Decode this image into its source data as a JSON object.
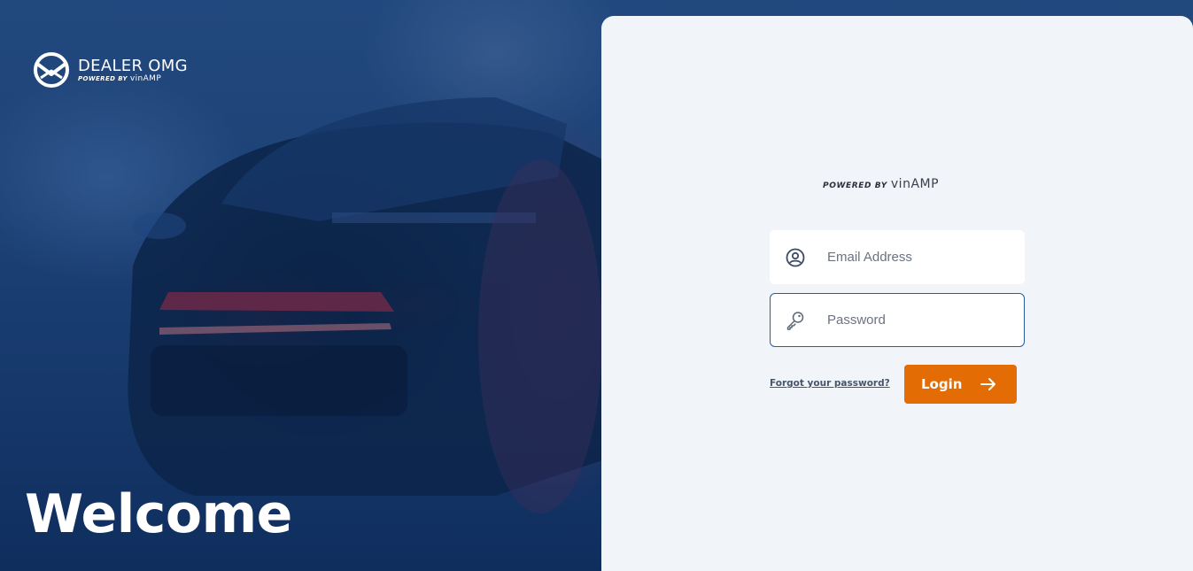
{
  "brand": {
    "name": "DEALER OMG",
    "powered_prefix": "POWERED BY",
    "powered_brand": "vinAMP"
  },
  "hero": {
    "welcome_text": "Welcome"
  },
  "login_panel": {
    "powered_prefix": "POWERED BY",
    "powered_brand": "vinAMP",
    "email": {
      "placeholder": "Email Address",
      "value": "",
      "icon": "user-circle-icon"
    },
    "password": {
      "placeholder": "Password",
      "value": "",
      "icon": "key-icon"
    },
    "forgot_link": "Forgot your password?",
    "login_button": {
      "label": "Login",
      "icon": "arrow-right-icon"
    }
  },
  "colors": {
    "primary_blue": "#0f2e5e",
    "panel_bg": "#f1f5f9",
    "accent_orange": "#e36d04",
    "focus_border": "#2b5aa8"
  }
}
